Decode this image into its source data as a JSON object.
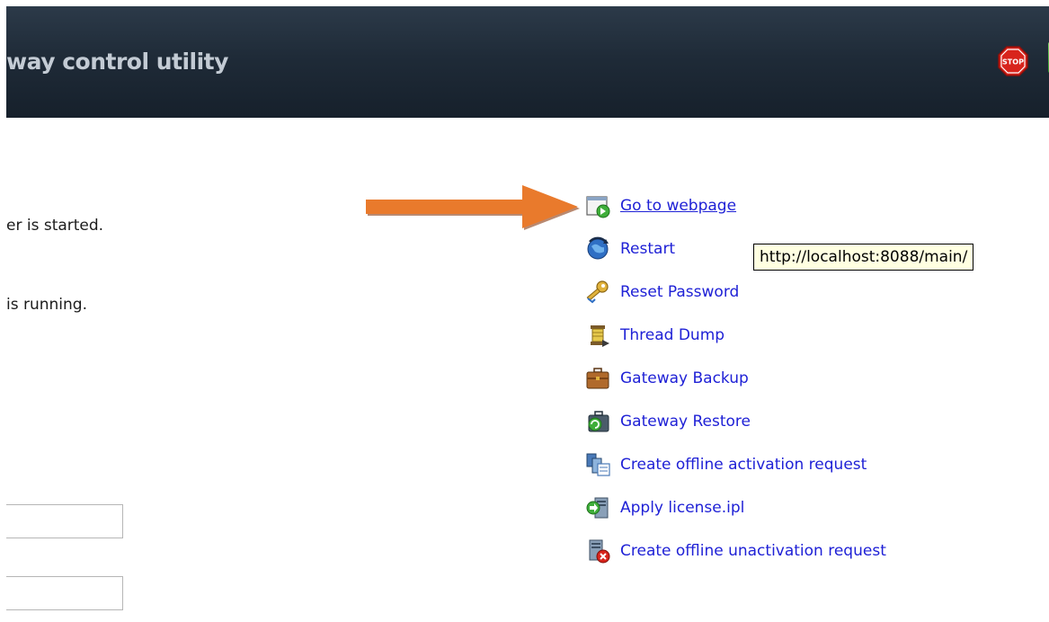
{
  "header": {
    "title": "way control utility",
    "stop_icon": "stop-sign-icon",
    "right_edge_icon": "start-icon"
  },
  "status": {
    "line1": "er is started.",
    "line2": "is running."
  },
  "annotation": {
    "arrow_color": "#e97a2c",
    "arrow_points_to": "Go to webpage"
  },
  "actions": [
    {
      "label": "Go to webpage",
      "icon": "webpage-go-icon"
    },
    {
      "label": "Restart",
      "icon": "restart-globe-icon"
    },
    {
      "label": "Reset Password",
      "icon": "key-icon"
    },
    {
      "label": "Thread Dump",
      "icon": "spool-icon"
    },
    {
      "label": "Gateway Backup",
      "icon": "briefcase-icon"
    },
    {
      "label": "Gateway Restore",
      "icon": "restore-briefcase-icon"
    },
    {
      "label": "Create offline activation request",
      "icon": "activation-request-icon"
    },
    {
      "label": "Apply license.ipl",
      "icon": "apply-license-icon"
    },
    {
      "label": "Create offline unactivation request",
      "icon": "unactivation-request-icon"
    }
  ],
  "tooltip": {
    "text": "http://localhost:8088/main/"
  },
  "colors": {
    "header_bg": "#1f2b38",
    "header_text": "#c3cbd4",
    "link_text": "#1f21d6",
    "tooltip_bg": "#ffffe1"
  }
}
